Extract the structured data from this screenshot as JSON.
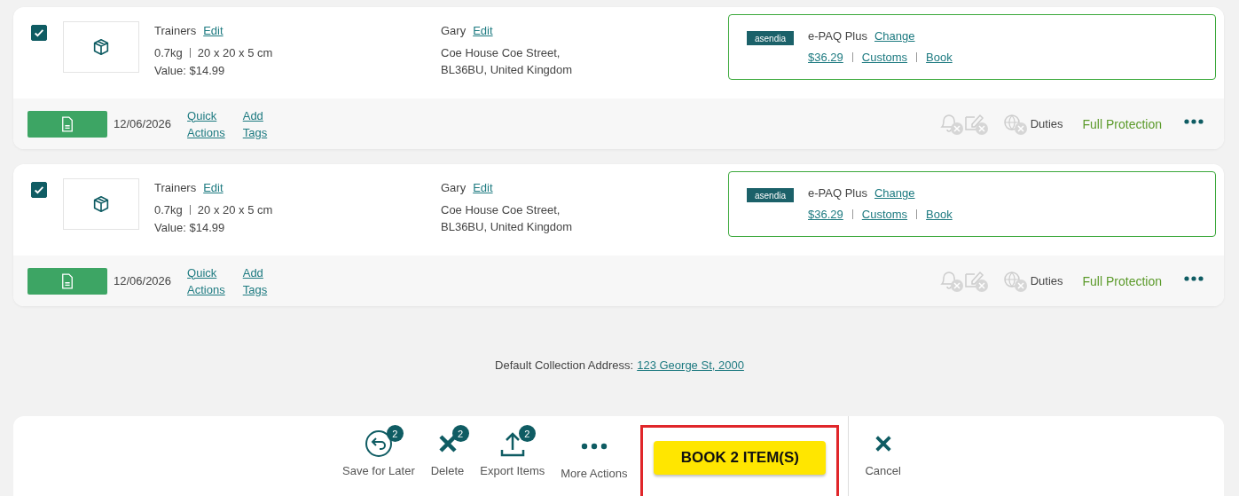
{
  "shipments": [
    {
      "checked": true,
      "item": "Trainers",
      "item_edit": "Edit",
      "weight": "0.7kg",
      "dimensions": "20 x 20 x 5 cm",
      "value": "Value: $14.99",
      "recipient": "Gary",
      "recipient_edit": "Edit",
      "address_line_1": "Coe House Coe Street,",
      "address_line_2": "BL36BU, United Kingdom",
      "carrier_logo": "asendia",
      "service": "e-PAQ Plus",
      "change": "Change",
      "price": "$36.29",
      "customs": "Customs",
      "book": "Book",
      "date": "12/06/2026",
      "quick_actions": [
        "Quick",
        "Actions"
      ],
      "add_tags": [
        "Add",
        "Tags"
      ],
      "duties": "Duties",
      "protection": "Full Protection"
    },
    {
      "checked": true,
      "item": "Trainers",
      "item_edit": "Edit",
      "weight": "0.7kg",
      "dimensions": "20 x 20 x 5 cm",
      "value": "Value: $14.99",
      "recipient": "Gary",
      "recipient_edit": "Edit",
      "address_line_1": "Coe House Coe Street,",
      "address_line_2": "BL36BU, United Kingdom",
      "carrier_logo": "asendia",
      "service": "e-PAQ Plus",
      "change": "Change",
      "price": "$36.29",
      "customs": "Customs",
      "book": "Book",
      "date": "12/06/2026",
      "quick_actions": [
        "Quick",
        "Actions"
      ],
      "add_tags": [
        "Add",
        "Tags"
      ],
      "duties": "Duties",
      "protection": "Full Protection"
    }
  ],
  "collection": {
    "label": "Default Collection Address:",
    "address": "123 George St, 2000"
  },
  "actions": [
    {
      "kind": "save",
      "label": "Save for Later",
      "badge": "2"
    },
    {
      "kind": "delete",
      "label": "Delete",
      "badge": "2"
    },
    {
      "kind": "export",
      "label": "Export Items",
      "badge": "2"
    },
    {
      "kind": "more",
      "label": "More Actions"
    }
  ],
  "book_button": {
    "label": "BOOK 2 ITEM(S)",
    "highlighted": true
  },
  "cancel": {
    "label": "Cancel"
  }
}
